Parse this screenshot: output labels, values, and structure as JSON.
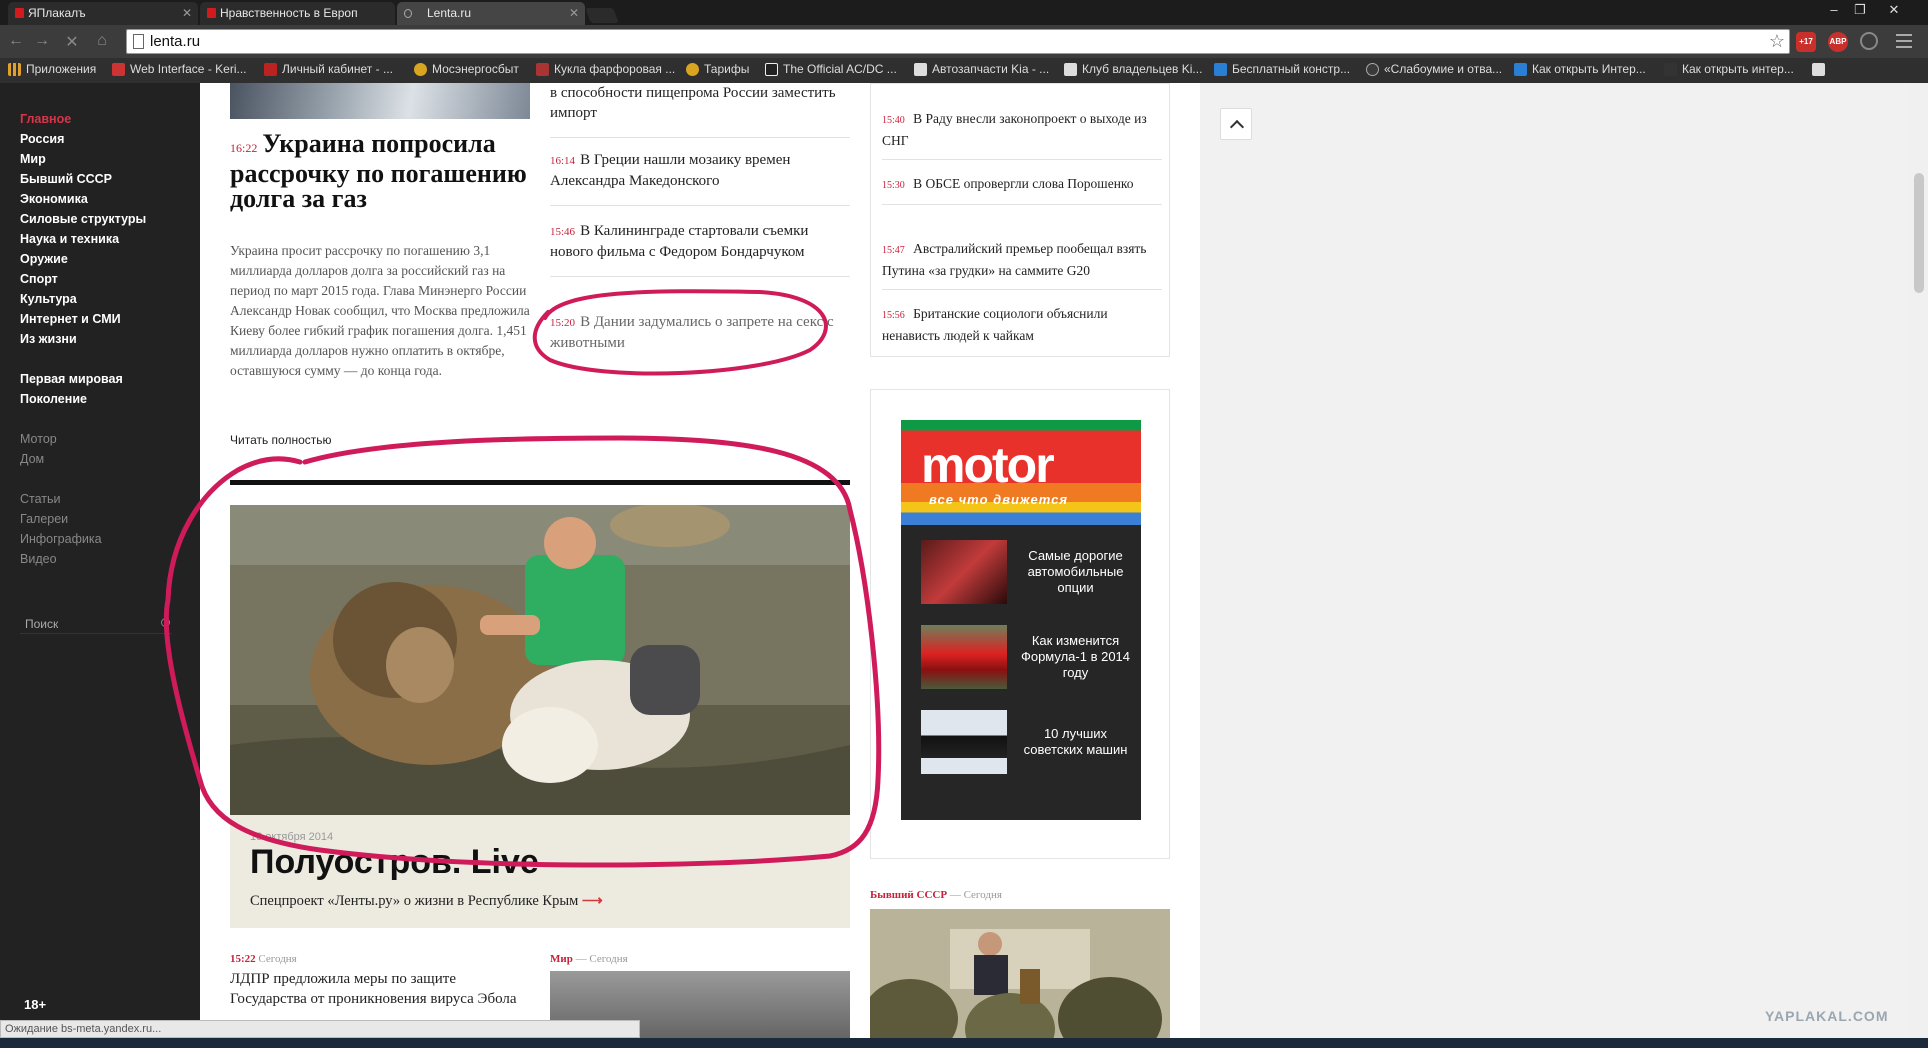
{
  "browser": {
    "tabs": [
      {
        "label": "ЯПлакалъ"
      },
      {
        "label": "Нравственность в Европ"
      },
      {
        "label": "Lenta.ru"
      }
    ],
    "url": "lenta.ru",
    "ext_badges": {
      "notify": "+17",
      "adblock": "ABP"
    },
    "bookmarks": [
      {
        "label": "Приложения"
      },
      {
        "label": "Web Interface - Keri..."
      },
      {
        "label": "Личный кабинет - ..."
      },
      {
        "label": "Мосэнергосбыт"
      },
      {
        "label": "Кукла фарфоровая ..."
      },
      {
        "label": "Тарифы"
      },
      {
        "label": "The Official AC/DC ..."
      },
      {
        "label": "Автозапчасти Kia - ..."
      },
      {
        "label": "Клуб владельцев Ki..."
      },
      {
        "label": "Бесплатный констр..."
      },
      {
        "label": "«Слабоумие и отва..."
      },
      {
        "label": "Как открыть Интер..."
      },
      {
        "label": "Как открыть интер..."
      }
    ],
    "status": "Ожидание bs-meta.yandex.ru..."
  },
  "nav": {
    "items": [
      {
        "label": "Главное"
      },
      {
        "label": "Россия"
      },
      {
        "label": "Мир"
      },
      {
        "label": "Бывший СССР"
      },
      {
        "label": "Экономика"
      },
      {
        "label": "Силовые структуры"
      },
      {
        "label": "Наука и техника"
      },
      {
        "label": "Оружие"
      },
      {
        "label": "Спорт"
      },
      {
        "label": "Культура"
      },
      {
        "label": "Интернет и СМИ"
      },
      {
        "label": "Из жизни"
      }
    ],
    "extra": [
      {
        "label": "Первая мировая"
      },
      {
        "label": "Поколение"
      }
    ],
    "sites": [
      {
        "label": "Мотор"
      },
      {
        "label": "Дом"
      }
    ],
    "formats": [
      {
        "label": "Статьи"
      },
      {
        "label": "Галереи"
      },
      {
        "label": "Инфографика"
      },
      {
        "label": "Видео"
      }
    ],
    "search_placeholder": "Поиск",
    "age": "18+"
  },
  "main": {
    "headline": {
      "time": "16:22",
      "title": "Украина попросила рассрочку по погашению долга за газ"
    },
    "lede": "Украина просит рассрочку по погашению 3,1 миллиарда долларов долга за российский газ на период по март 2015 года. Глава Минэнерго России Александр Новак сообщил, что Москва предложила Киеву более гибкий график погашения долга. 1,451 миллиарда долларов нужно оплатить в октябре, оставшуюся сумму — до конца года.",
    "read_more": "Читать полностью",
    "col2": [
      {
        "time": "",
        "text": "в способности пищепрома России заместить импорт"
      },
      {
        "time": "16:14",
        "text": "В Греции нашли мозаику времен Александра Македонского"
      },
      {
        "time": "15:46",
        "text": "В Калининграде стартовали съемки нового фильма с Федором Бондарчуком"
      },
      {
        "time": "15:20",
        "text": "В Дании задумались о запрете на секс с животными"
      }
    ],
    "hero": {
      "date": "13 октября 2014",
      "title": "Полуостров. Live",
      "sub": "Спецпроект «Ленты.ру» о жизни в Республике Крым",
      "arrow": "⟶"
    },
    "bottom": [
      {
        "time": "15:22",
        "section": "",
        "when": "Сегодня",
        "text": "ЛДПР предложила меры по защите Государства от проникновения вируса Эбола"
      },
      {
        "time": "",
        "section": "Мир",
        "when": "— Сегодня",
        "text": ""
      }
    ]
  },
  "right": {
    "news": [
      {
        "time": "15:40",
        "text": "В Раду внесли законопроект о выходе из СНГ"
      },
      {
        "time": "15:30",
        "text": "В ОБСЕ опровергли слова Порошенко"
      },
      {
        "time": "15:47",
        "text": "Австралийский премьер пообещал взять Путина «за грудки» на саммите G20"
      },
      {
        "time": "15:56",
        "text": "Британские социологи объяснили ненависть людей к чайкам"
      }
    ],
    "motor": {
      "logo": "motor",
      "tagline": "все что движется",
      "items": [
        {
          "text": "Самые дорогие автомобильные опции"
        },
        {
          "text": "Как изменится Формула-1 в 2014 году"
        },
        {
          "text": "10 лучших советских машин"
        }
      ]
    },
    "section": {
      "name": "Бывший СССР",
      "when": "— Сегодня"
    }
  },
  "watermark": "YAPLAKAL.COM"
}
